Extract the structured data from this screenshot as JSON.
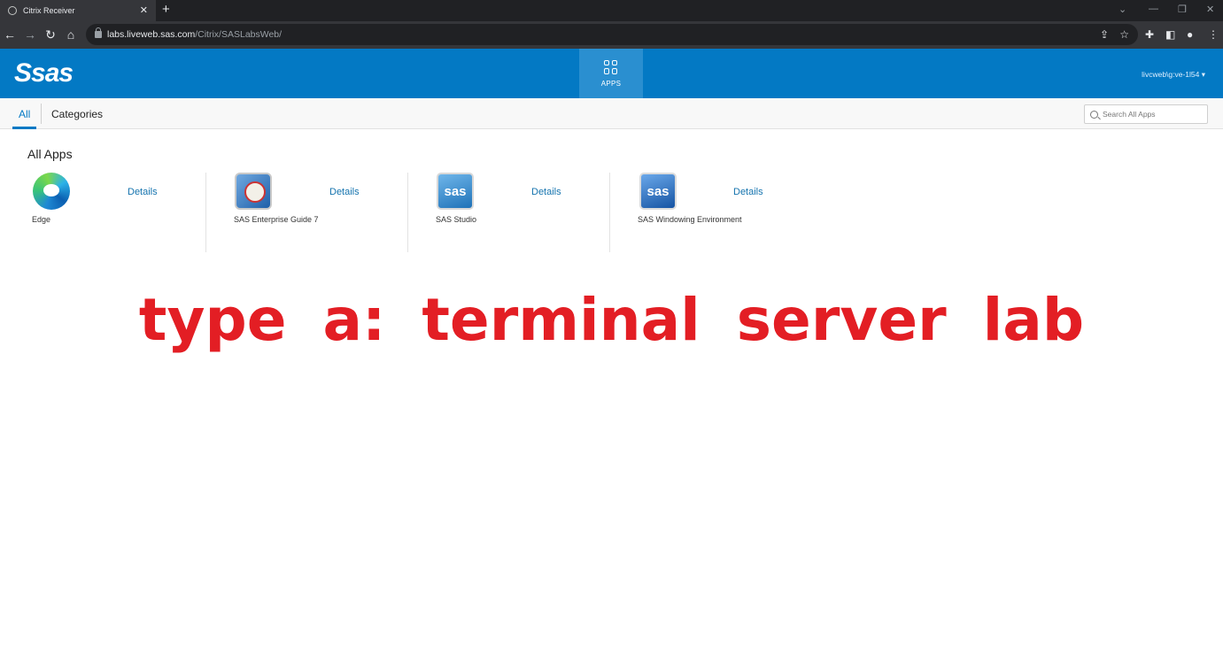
{
  "browser": {
    "tab_title": "Citrix Receiver",
    "tab_close": "✕",
    "new_tab": "+",
    "url_host": "labs.liveweb.sas.com",
    "url_path": "/Citrix/SASLabsWeb/"
  },
  "header": {
    "logo": "Ssas",
    "apps_label": "APPS",
    "user": "livcweb\\g:ve-1l54 ▾"
  },
  "subnav": {
    "tabs": [
      {
        "label": "All"
      },
      {
        "label": "Categories"
      }
    ],
    "search_placeholder": "Search All Apps"
  },
  "main": {
    "section_title": "All Apps",
    "apps": [
      {
        "name": "Edge",
        "details": "Details",
        "icon": "edge-browser-icon"
      },
      {
        "name": "SAS Enterprise Guide 7",
        "details": "Details",
        "icon": "sas-enterprise-guide-icon"
      },
      {
        "name": "SAS Studio",
        "details": "Details",
        "icon": "sas-studio-icon",
        "tile_text": "sas"
      },
      {
        "name": "SAS Windowing Environment",
        "details": "Details",
        "icon": "sas-windowing-icon",
        "tile_text": "sas"
      }
    ]
  },
  "overlay": {
    "text": "type a: terminal server lab",
    "color": "#e31e24"
  },
  "colors": {
    "brand_blue": "#0379c4",
    "link_blue": "#1473ae"
  }
}
